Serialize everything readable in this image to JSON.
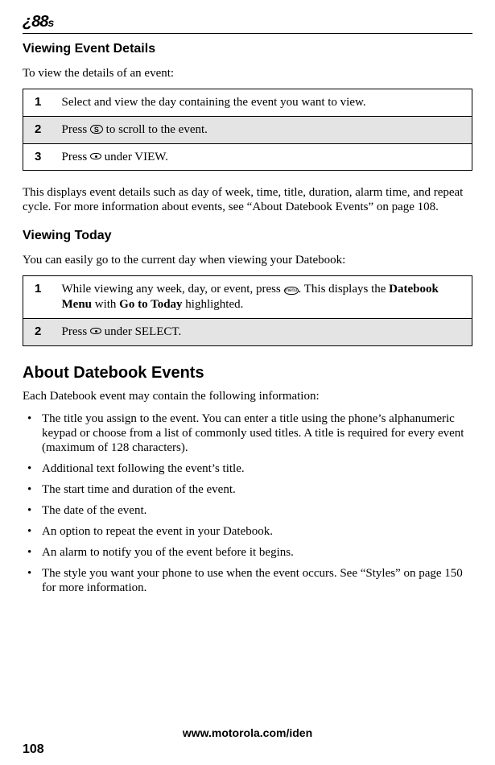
{
  "logo": "¿88",
  "logo_s": "s",
  "section1": {
    "heading": "Viewing Event Details",
    "intro": "To view the details of an event:",
    "steps": [
      {
        "num": "1",
        "text": "Select and view the day containing the event you want to view."
      },
      {
        "num": "2",
        "pre": "Press ",
        "post": " to scroll to the event.",
        "icon_label": "S"
      },
      {
        "num": "3",
        "pre": "Press ",
        "post": " under VIEW."
      }
    ],
    "after": "This displays event details such as day of week, time, title, duration, alarm time, and repeat cycle. For more information about events, see “About Datebook Events” on page 108."
  },
  "section2": {
    "heading": "Viewing Today",
    "intro": "You can easily go to the current day when viewing your Datebook:",
    "steps": [
      {
        "num": "1",
        "pre": "While viewing any week, day, or event, press ",
        "post": ". This displays the ",
        "bold1": "Datebook Menu",
        "mid": " with ",
        "bold2": "Go to Today",
        "end": " highlighted."
      },
      {
        "num": "2",
        "pre": "Press ",
        "post": " under SELECT."
      }
    ]
  },
  "section3": {
    "heading": "About Datebook Events",
    "intro": "Each Datebook event may contain the following information:",
    "bullets": [
      "The title you assign to the event. You can enter a title using the phone’s alphanumeric keypad or choose from a list of commonly used titles. A title is required for every event (maximum of 128 characters).",
      "Additional text following the event’s title.",
      "The start time and duration of the event.",
      "The date of the event.",
      "An option to repeat the event in your Datebook.",
      "An alarm to notify you of the event before it begins.",
      "The style you want your phone to use when the event occurs. See “Styles” on page 150 for more information."
    ]
  },
  "footer": {
    "url": "www.motorola.com/iden",
    "page": "108"
  },
  "icons": {
    "menu_text": "menu"
  }
}
